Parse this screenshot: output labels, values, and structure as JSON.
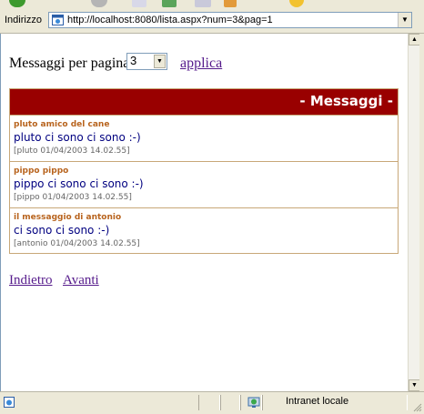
{
  "addressbar": {
    "label": "Indirizzo",
    "url": "http://localhost:8080/lista.aspx?num=3&pag=1"
  },
  "page": {
    "messages_per_page_label": "Messaggi per pagina",
    "page_size_selected": "3",
    "apply_label": "applica",
    "header_title": "- Messaggi -",
    "messages": [
      {
        "title": "pluto amico del cane",
        "body": "pluto ci sono ci sono :-)",
        "meta": "[pluto 01/04/2003 14.02.55]"
      },
      {
        "title": "pippo pippo",
        "body": "pippo ci sono ci sono :-)",
        "meta": "[pippo 01/04/2003 14.02.55]"
      },
      {
        "title": "il messaggio di antonio",
        "body": "ci sono ci sono :-)",
        "meta": "[antonio 01/04/2003 14.02.55]"
      }
    ],
    "prev_label": "Indietro",
    "next_label": "Avanti"
  },
  "statusbar": {
    "zone": "Intranet locale"
  },
  "colors": {
    "header_bg": "#990000",
    "title": "#b8641e",
    "body_text": "#000080",
    "link_visited": "#551a8b",
    "border": "#c8a878"
  },
  "icons": {
    "page": "page-icon",
    "zone": "intranet-icon",
    "status": "ie-page-icon"
  }
}
